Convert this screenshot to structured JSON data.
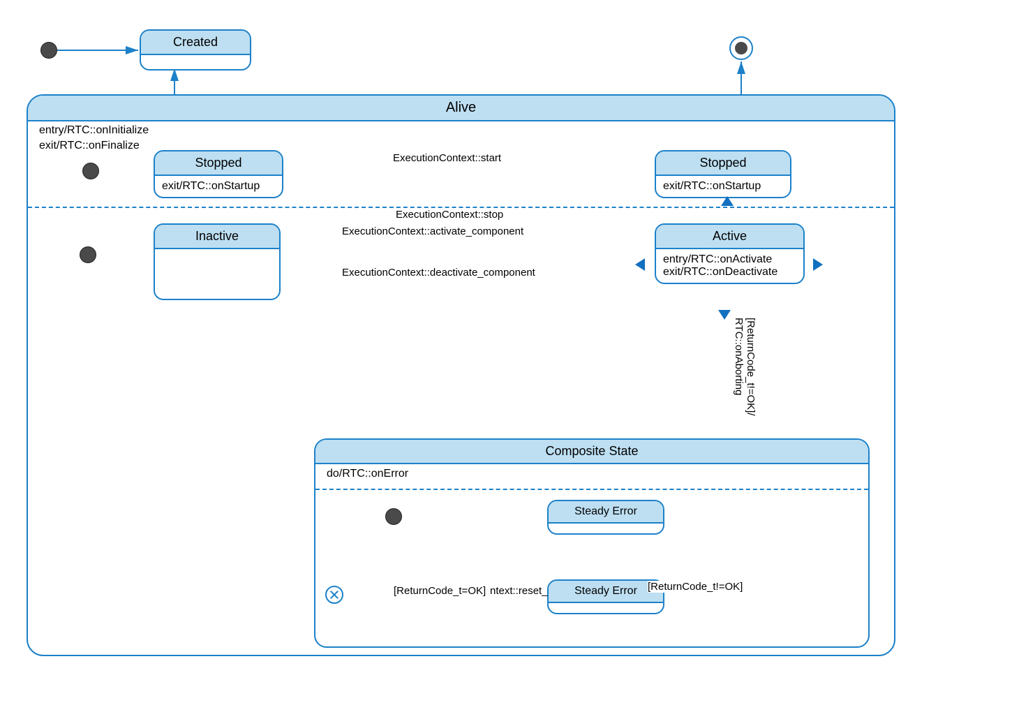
{
  "colors": {
    "stroke": "#1c81c9",
    "fill_header": "#bedff2",
    "initial_fill": "#4a4a4a"
  },
  "states": {
    "created": {
      "title": "Created"
    },
    "alive": {
      "title": "Alive",
      "entry": "entry/RTC::onInitialize",
      "exit": "exit/RTC::onFinalize"
    },
    "stopped1": {
      "title": "Stopped",
      "body": "exit/RTC::onStartup"
    },
    "stopped2": {
      "title": "Stopped",
      "body": "exit/RTC::onStartup"
    },
    "inactive": {
      "title": "Inactive"
    },
    "active": {
      "title": "Active",
      "entry": "entry/RTC::onActivate",
      "exit": "exit/RTC::onDeactivate"
    },
    "composite": {
      "title": "Composite State",
      "do": "do/RTC::onError"
    },
    "steady1": {
      "title": "Steady Error"
    },
    "steady2": {
      "title": "Steady Error"
    }
  },
  "transitions": {
    "ec_start": "ExecutionContext::start",
    "ec_stop": "ExecutionContext::stop",
    "ec_activate": "ExecutionContext::activate_component",
    "ec_deactivate": "ExecutionContext::deactivate_component",
    "aborting": "[ReturnCode_t!=OK]/\nRTC::onAborting",
    "reset_ok": "[ReturnCode_t=OK]",
    "reset_evt": "ntext::reset_",
    "retry_notok": "[ReturnCode_t!=OK]"
  }
}
